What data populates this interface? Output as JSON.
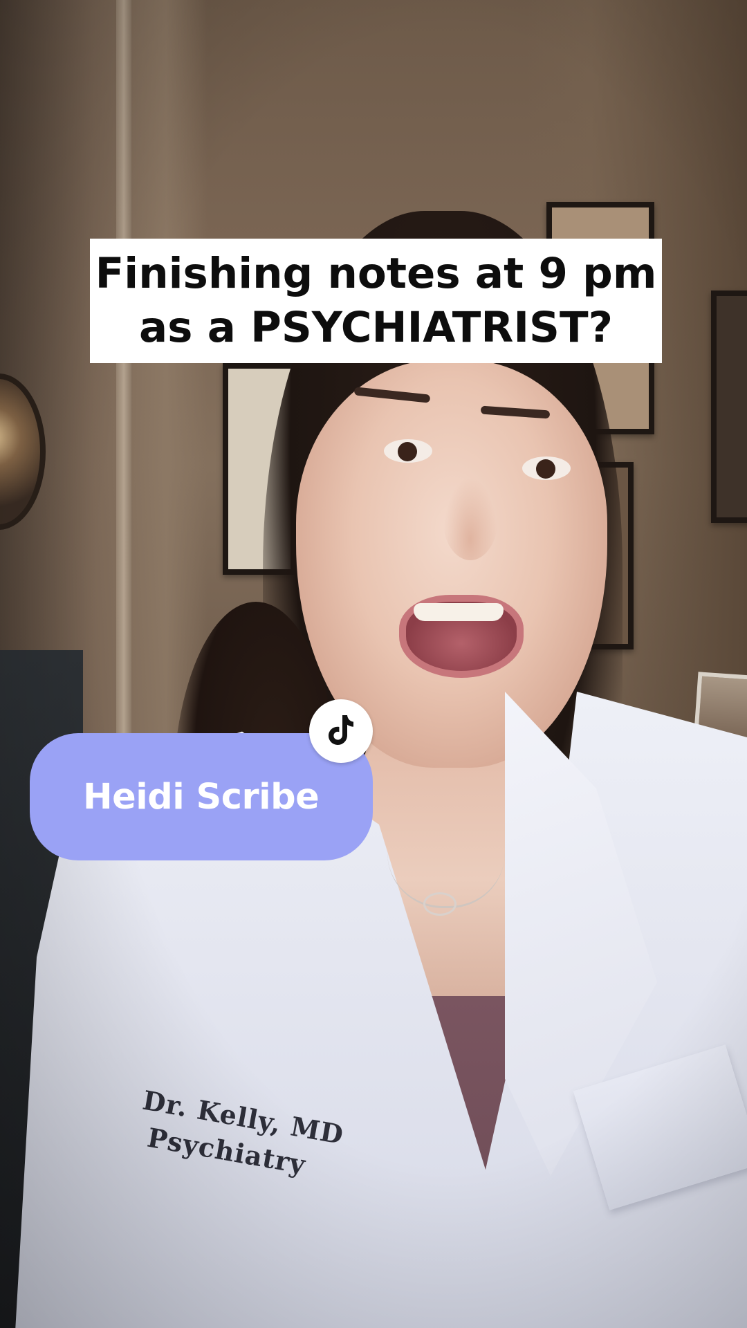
{
  "overlay": {
    "caption_line1": "Finishing notes at 9 pm",
    "caption_line2": "as a PSYCHIATRIST?"
  },
  "sticker": {
    "label": "Heidi Scribe",
    "badge_icon": "tiktok-icon",
    "color": "#9aa2f5"
  },
  "scene": {
    "coat_embroidery_line1": "Dr. Kelly, MD",
    "coat_embroidery_line2": "Psychiatry"
  }
}
